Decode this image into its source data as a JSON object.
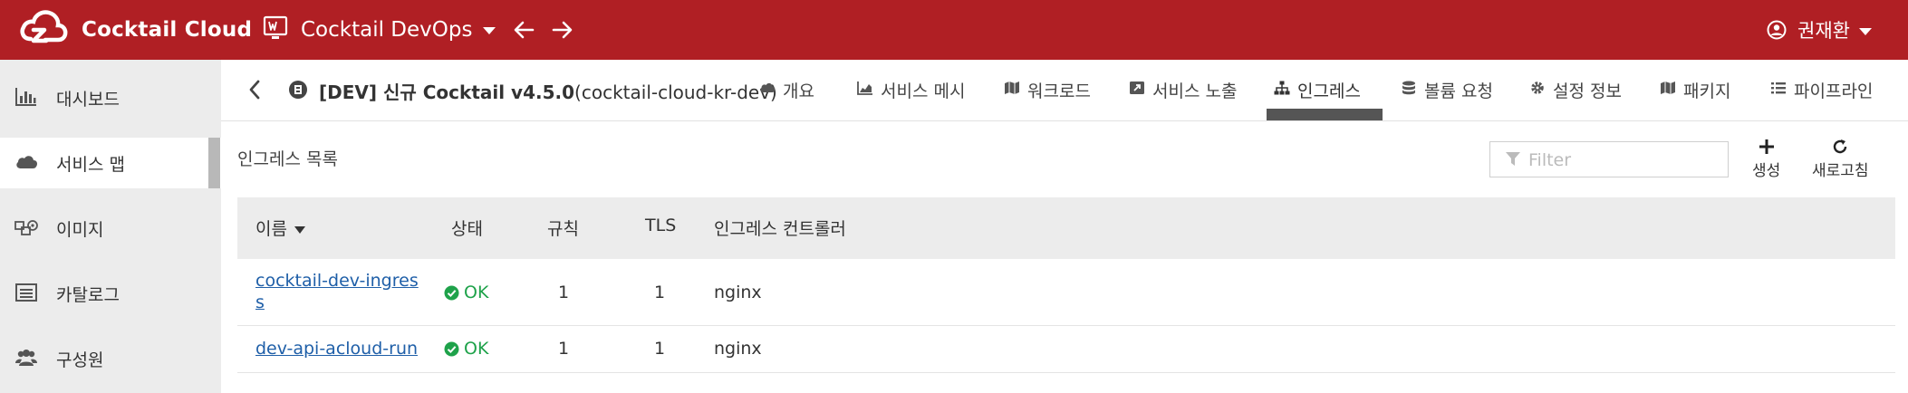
{
  "header": {
    "brand": "Cocktail Cloud",
    "workspace": "Cocktail DevOps",
    "user": "권재환",
    "colors": {
      "header_bg": "#b01f24"
    }
  },
  "sidebar": {
    "items": [
      {
        "label": "대시보드",
        "icon": "bar-chart-icon"
      },
      {
        "label": "서비스 맵",
        "icon": "cloud-icon",
        "active": true
      },
      {
        "label": "이미지",
        "icon": "cubes-icon"
      },
      {
        "label": "카탈로그",
        "icon": "list-alt-icon"
      },
      {
        "label": "구성원",
        "icon": "users-icon"
      }
    ]
  },
  "context": {
    "title_bold": "[DEV] 신규 Cocktail v4.5.0",
    "title_rest": "(cocktail-cloud-kr-dev)",
    "tabs": [
      {
        "label": "개요",
        "icon": "cloud-icon"
      },
      {
        "label": "서비스 메시",
        "icon": "area-chart-icon"
      },
      {
        "label": "워크로드",
        "icon": "map-icon"
      },
      {
        "label": "서비스 노출",
        "icon": "external-link-icon"
      },
      {
        "label": "인그레스",
        "icon": "sitemap-icon",
        "active": true
      },
      {
        "label": "볼륨 요청",
        "icon": "database-icon"
      },
      {
        "label": "설정 정보",
        "icon": "gear-icon"
      },
      {
        "label": "패키지",
        "icon": "map-icon"
      },
      {
        "label": "파이프라인",
        "icon": "list-icon"
      }
    ]
  },
  "content": {
    "section_title": "인그레스 목록",
    "filter_placeholder": "Filter",
    "actions": {
      "create": "생성",
      "refresh": "새로고침"
    }
  },
  "table": {
    "columns": [
      "이름",
      "상태",
      "규칙",
      "TLS",
      "인그레스 컨트롤러"
    ],
    "rows": [
      {
        "name_line1": "cocktail-dev-ingres",
        "name_line2": "s",
        "status": "OK",
        "rules": "1",
        "tls": "1",
        "controller": "nginx"
      },
      {
        "name_line1": "dev-api-acloud-run",
        "name_line2": "",
        "status": "OK",
        "rules": "1",
        "tls": "1",
        "controller": "nginx"
      }
    ],
    "colors": {
      "link": "#1f5fa8",
      "ok": "#1ea24a"
    }
  }
}
